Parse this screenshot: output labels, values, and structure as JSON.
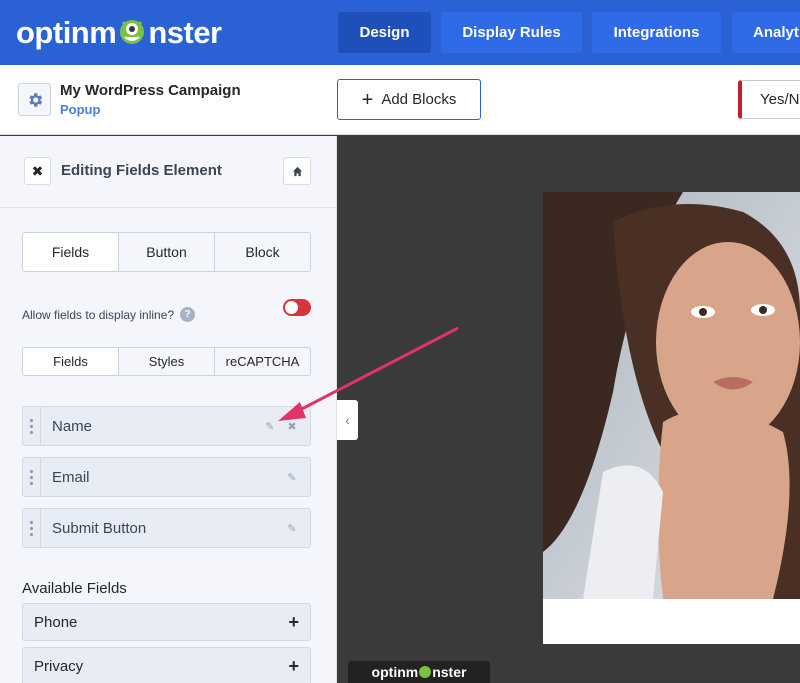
{
  "brand": {
    "logo_pre": "optinm",
    "logo_post": "nster",
    "footer_pre": "optinm",
    "footer_post": "nster"
  },
  "nav": {
    "tabs": [
      {
        "label": "Design"
      },
      {
        "label": "Display Rules"
      },
      {
        "label": "Integrations"
      },
      {
        "label": "Analyt"
      }
    ]
  },
  "campaign": {
    "title": "My WordPress Campaign",
    "type": "Popup"
  },
  "toolbar": {
    "add_blocks_label": "Add Blocks",
    "yesno_label": "Yes/N"
  },
  "sidebar": {
    "title": "Editing Fields Element",
    "main_tabs": [
      {
        "label": "Fields"
      },
      {
        "label": "Button"
      },
      {
        "label": "Block"
      }
    ],
    "inline_label": "Allow fields to display inline?",
    "sub_tabs": [
      {
        "label": "Fields"
      },
      {
        "label": "Styles"
      },
      {
        "label": "reCAPTCHA"
      }
    ],
    "fields": [
      {
        "label": "Name"
      },
      {
        "label": "Email"
      },
      {
        "label": "Submit Button"
      }
    ],
    "available_title": "Available Fields",
    "available": [
      {
        "label": "Phone"
      },
      {
        "label": "Privacy"
      }
    ]
  },
  "colors": {
    "nav_bg": "#2a62d6",
    "nav_active": "#1f4fb8",
    "toggle_off": "#d8343e",
    "arrow": "#e0336b"
  },
  "icons": {
    "gear": "gear-icon",
    "close": "close-icon",
    "home": "home-icon",
    "pencil": "pencil-icon",
    "remove": "x-icon",
    "plus": "plus-icon",
    "help": "help-icon",
    "chevron": "chevron-left-icon"
  }
}
